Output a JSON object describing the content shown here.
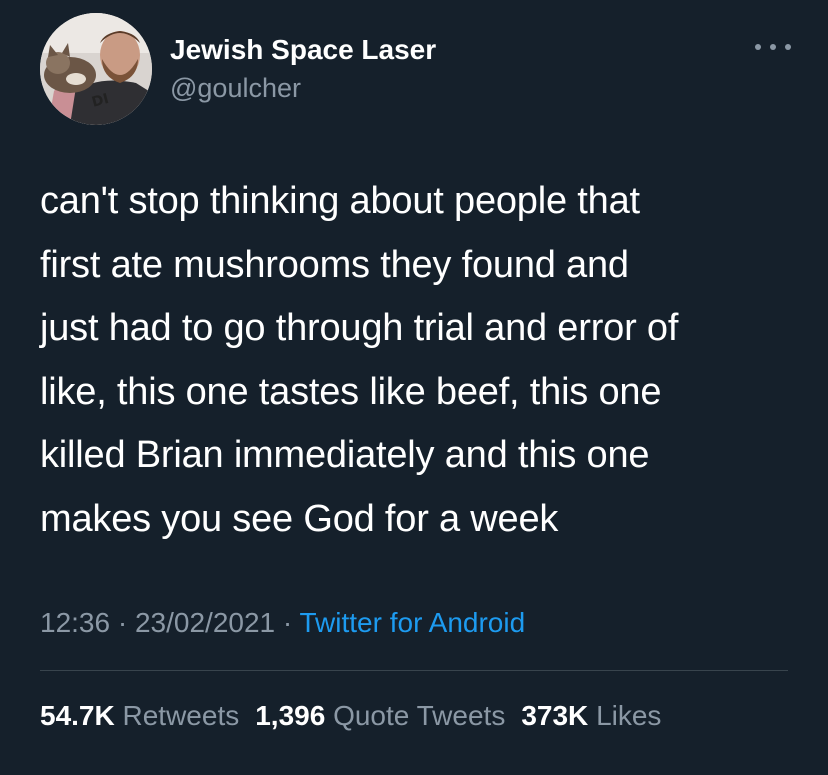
{
  "tweet": {
    "author": {
      "display_name": "Jewish Space Laser",
      "handle": "@goulcher"
    },
    "body_lines": [
      "can't stop thinking about people that",
      "first ate mushrooms they found and",
      "just had to go through trial and error of",
      "like, this one tastes like beef, this one",
      "killed Brian immediately and this one",
      "makes you see God for a week"
    ],
    "time": "12:36",
    "separator": "·",
    "date": "23/02/2021",
    "source": "Twitter for Android",
    "stats": {
      "retweets": {
        "count": "54.7K",
        "label": "Retweets"
      },
      "quote_tweets": {
        "count": "1,396",
        "label": "Quote Tweets"
      },
      "likes": {
        "count": "373K",
        "label": "Likes"
      }
    }
  },
  "icons": {
    "more": "more-horizontal-icon"
  },
  "colors": {
    "background": "#15202b",
    "text_primary": "#ffffff",
    "text_secondary": "#8b98a5",
    "link": "#1d9bf0",
    "divider": "#38444d"
  }
}
